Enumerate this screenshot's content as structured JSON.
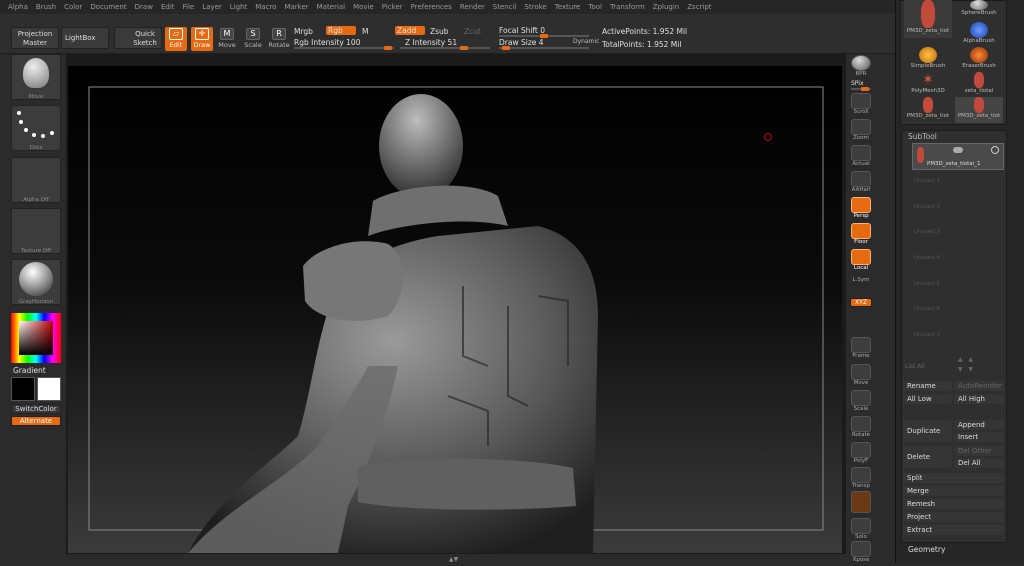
{
  "menu": [
    "Alpha",
    "Brush",
    "Color",
    "Document",
    "Draw",
    "Edit",
    "File",
    "Layer",
    "Light",
    "Macro",
    "Marker",
    "Material",
    "Movie",
    "Picker",
    "Preferences",
    "Render",
    "Stencil",
    "Stroke",
    "Texture",
    "Tool",
    "Transform",
    "Zplugin",
    "Zscript"
  ],
  "toolbar": {
    "projection_master": "Projection Master",
    "lightbox": "LightBox",
    "quick_sketch": "Quick Sketch",
    "edit": "Edit",
    "draw": "Draw",
    "move": "Move",
    "scale": "Scale",
    "rotate": "Rotate",
    "mrgb": "Mrgb",
    "rgb": "Rgb",
    "m": "M",
    "zadd": "Zadd",
    "zsub": "Zsub",
    "zcut": "Zcut",
    "rgb_intensity": "Rgb Intensity 100",
    "z_intensity": "Z Intensity 51",
    "focal_shift": "Focal Shift 0",
    "draw_size": "Draw Size 4",
    "dynamic": "Dynamic",
    "active_points": "ActivePoints: 1.952 Mil",
    "total_points": "TotalPoints: 1.952 Mil"
  },
  "left": {
    "move": "Move",
    "dots": "Dots",
    "alpha_off": "Alpha Off",
    "texture_off": "Texture Off",
    "material": "GrayHorizon",
    "gradient": "Gradient",
    "switch_color": "SwitchColor",
    "alternate": "Alternate"
  },
  "shelf": [
    "BPR",
    "SPix",
    "Scroll",
    "Zoom",
    "Actual",
    "AAHalf",
    "Persp",
    "Floor",
    "Local",
    "L.Sym",
    "XYZ",
    "Frame",
    "Move",
    "Scale",
    "Rotate",
    "PolyF",
    "Transp",
    "Ghost",
    "Solo",
    "Xpose"
  ],
  "brushes": [
    "SphereBrush",
    "AlphaBrush",
    "SimpleBrush",
    "EraserBrush",
    "PolyMesh3D",
    "zeta_tiotai",
    "PM3D_zeta_tiot",
    "PM3D_zeta_tiot"
  ],
  "brush_top_caption": "PM3D_zeta_tiot",
  "subtool": {
    "title": "SubTool",
    "active": "PM3D_zeta_tiotai_1",
    "unused": [
      "Unused 1",
      "Unused 2",
      "Unused 3",
      "Unused 4",
      "Unused 5",
      "Unused 6",
      "Unused 7"
    ],
    "list_all": "List All",
    "rename": "Rename",
    "autoreorder": "AutoReorder",
    "all_low": "All Low",
    "all_high": "All High",
    "duplicate": "Duplicate",
    "append": "Append",
    "insert": "Insert",
    "delete": "Delete",
    "del_other": "Del Other",
    "del_all": "Del All",
    "split": "Split",
    "merge": "Merge",
    "remesh": "Remesh",
    "project": "Project",
    "extract": "Extract",
    "geometry": "Geometry"
  },
  "colors": {
    "accent": "#e66a12",
    "bg": "#2b2b2b"
  }
}
